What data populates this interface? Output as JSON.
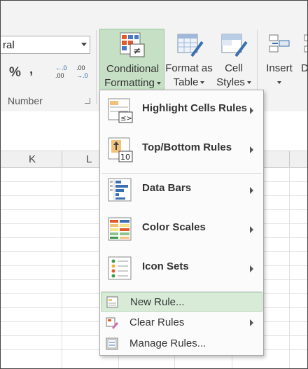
{
  "ribbon": {
    "number_format_value": "ral",
    "percent_symbol": "%",
    "comma_symbol": ",",
    "increase_decimal": {
      "top": "←.0",
      "bottom": ".00"
    },
    "decrease_decimal": {
      "top": ".00",
      "bottom": "→.0"
    },
    "number_group_label": "Number",
    "buttons": {
      "conditional_formatting": {
        "line1": "Conditional",
        "line2": "Formatting"
      },
      "format_as_table": {
        "line1": "Format as",
        "line2": "Table"
      },
      "cell_styles": {
        "line1": "Cell",
        "line2": "Styles"
      },
      "insert": {
        "line1": "Insert"
      },
      "delete_partial": {
        "line1": "D"
      }
    }
  },
  "sheet": {
    "columns": [
      "K",
      "L"
    ]
  },
  "menu": {
    "items": [
      {
        "label": "Highlight Cells Rules",
        "icon": "highlight-cells-rules-icon",
        "has_submenu": true
      },
      {
        "label": "Top/Bottom Rules",
        "icon": "top-bottom-rules-icon",
        "icon_text": "10",
        "has_submenu": true
      },
      {
        "label": "Data Bars",
        "icon": "data-bars-icon",
        "has_submenu": true
      },
      {
        "label": "Color Scales",
        "icon": "color-scales-icon",
        "has_submenu": true
      },
      {
        "label": "Icon Sets",
        "icon": "icon-sets-icon",
        "has_submenu": true
      }
    ],
    "small_items": [
      {
        "label": "New Rule...",
        "icon": "new-rule-icon",
        "highlighted": true,
        "has_submenu": false
      },
      {
        "label": "Clear Rules",
        "icon": "clear-rules-icon",
        "highlighted": false,
        "has_submenu": true
      },
      {
        "label": "Manage Rules...",
        "icon": "manage-rules-icon",
        "highlighted": false,
        "has_submenu": false
      }
    ],
    "highlight_icon_text": "≤>"
  },
  "colors": {
    "active_button": "#c5e0c5",
    "menu_highlight": "#d7ebd7",
    "ribbon_bg": "#f3f3f3"
  }
}
